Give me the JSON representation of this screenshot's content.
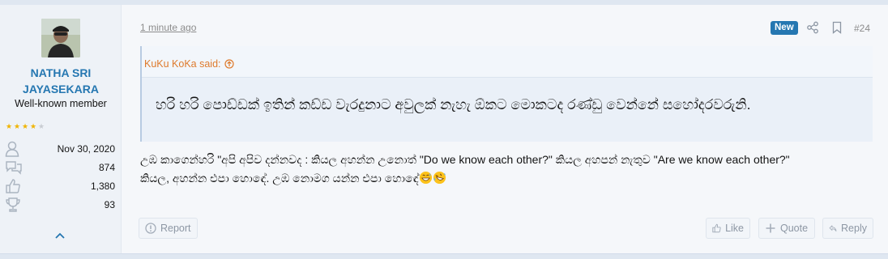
{
  "user": {
    "name": "NATHA SRI JAYASEKARA",
    "title": "Well-known member",
    "rating_stars": 4.5,
    "stats": [
      {
        "icon": "user-icon",
        "value": "Nov 30, 2020"
      },
      {
        "icon": "messages-icon",
        "value": "874"
      },
      {
        "icon": "thumbs-up-icon",
        "value": "1,380"
      },
      {
        "icon": "trophy-icon",
        "value": "93"
      }
    ]
  },
  "post": {
    "timestamp": "1 minute ago",
    "badge": "New",
    "post_number": "#24",
    "quote": {
      "author": "KuKu KoKa said:",
      "text": "හරි හරි පොඩ්ඩක් ඉතින් කඩ්ඩ වැරදුනාට අවුලක් නැහැ ඕකට මොකටද රණ්ඩු වෙන්නේ සහෝදරවරුනි."
    },
    "body_line1": "උඹ කාගෙන්හරි \"අපි අපිව දන්නවද : කියල අහන්න උනොත් \"Do we know each other?\" කියල අහපන් නැතුව \"Are we know each other?\"",
    "body_line2": "කියල, අහන්න එපා හොඳේ. උඹ නොමග යන්න එපා හොඳේ"
  },
  "actions": {
    "report": "Report",
    "like": "Like",
    "quote": "Quote",
    "reply": "Reply"
  },
  "colors": {
    "accent": "#2577b1",
    "quote_author": "#de7a2c",
    "star": "#f0b400"
  }
}
